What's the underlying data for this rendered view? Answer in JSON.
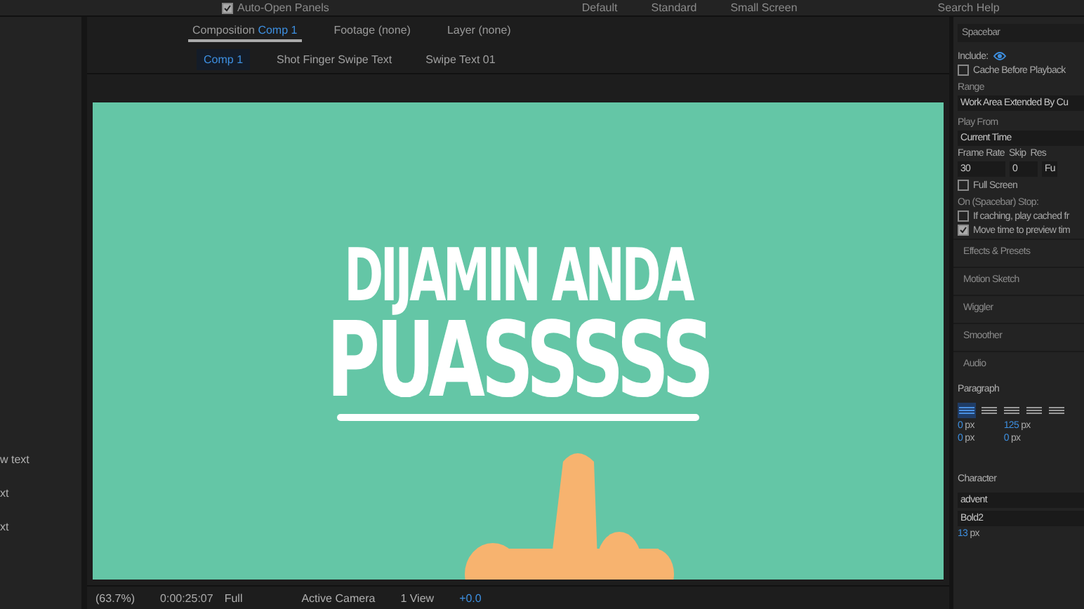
{
  "toolbar": {
    "auto_open": {
      "label": "Auto-Open Panels",
      "checked": true
    },
    "workspaces": [
      "Default",
      "Standard",
      "Small Screen"
    ],
    "search": {
      "placeholder": "Search Help"
    }
  },
  "left_panel": {
    "rows": [
      "w text",
      "xt",
      "xt"
    ]
  },
  "panel_tabs": [
    {
      "label": "Composition",
      "name": "Comp 1",
      "selected": true
    },
    {
      "label": "Footage",
      "name": "(none)",
      "selected": false
    },
    {
      "label": "Layer",
      "name": "(none)",
      "selected": false
    }
  ],
  "breadcrumbs": [
    {
      "label": "Comp 1",
      "selected": true
    },
    {
      "label": "Shot Finger Swipe Text",
      "selected": false
    },
    {
      "label": "Swipe Text 01",
      "selected": false
    }
  ],
  "viewer": {
    "line_1": "DIJAMIN ANDA",
    "line_2": "PUASSSSS"
  },
  "viewer_bar": {
    "zoom": "(63.7%)",
    "timecode": "0:00:25:07",
    "resolution": "Full",
    "camera": "Active Camera",
    "views": "1 View",
    "exposure": "+0.0"
  },
  "preview": {
    "title": "Spacebar",
    "include_label": "Include:",
    "cache_before": {
      "label": "Cache Before Playback",
      "checked": false
    },
    "range_label": "Range",
    "range": "Work Area Extended By Cu",
    "play_from_label": "Play From",
    "play_from": "Current Time",
    "frame_rate_label": "Frame Rate",
    "skip_label": "Skip",
    "res_label": "Res",
    "frame_rate": "30",
    "skip": "0",
    "res": "Fu",
    "full_screen": {
      "label": "Full Screen",
      "checked": false
    },
    "stop_label": "On (Spacebar) Stop:",
    "stop_options": [
      {
        "label": "If caching, play cached fr",
        "checked": false
      },
      {
        "label": "Move time to preview tim",
        "checked": true
      }
    ]
  },
  "collapsed_panels": [
    "Effects & Presets",
    "Motion Sketch",
    "Wiggler",
    "Smoother",
    "Audio"
  ],
  "paragraph": {
    "title": "Paragraph",
    "align": [
      {
        "selected": true
      },
      {
        "selected": false
      },
      {
        "selected": false
      },
      {
        "selected": false
      },
      {
        "selected": false
      }
    ],
    "indent_left": {
      "value": "0",
      "unit": "px"
    },
    "indent_first": {
      "value": "0",
      "unit": "px"
    },
    "space_before": {
      "value": "125",
      "unit": "px"
    },
    "space_after": {
      "value": "0",
      "unit": "px"
    }
  },
  "character": {
    "title": "Character",
    "font": "advent",
    "style": "Bold2",
    "size": "13",
    "unit": "px"
  }
}
